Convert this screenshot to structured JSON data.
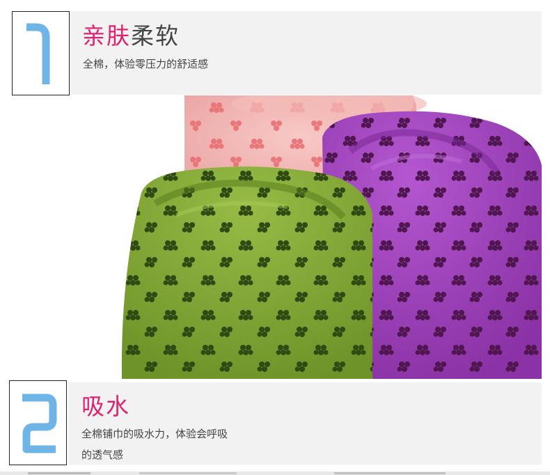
{
  "sections": [
    {
      "number_icon": "digit-one-glyph",
      "title_accent": "亲肤",
      "title_rest": "柔软",
      "subtitle": "全棉，体验零压力的舒适感"
    },
    {
      "number_icon": "digit-two-glyph",
      "title_accent": "吸水",
      "title_rest": "",
      "subtitle_line1": "全棉铺巾的吸水力，体验会呼吸",
      "subtitle_line2": "的透气感"
    }
  ],
  "colors": {
    "accent": "#e0226e",
    "numeral": "#6fb4e6",
    "band": "#f2f2f2",
    "towel_pink": "#f2b3b3",
    "towel_purple": "#9a3fb8",
    "towel_green": "#7fa534"
  }
}
